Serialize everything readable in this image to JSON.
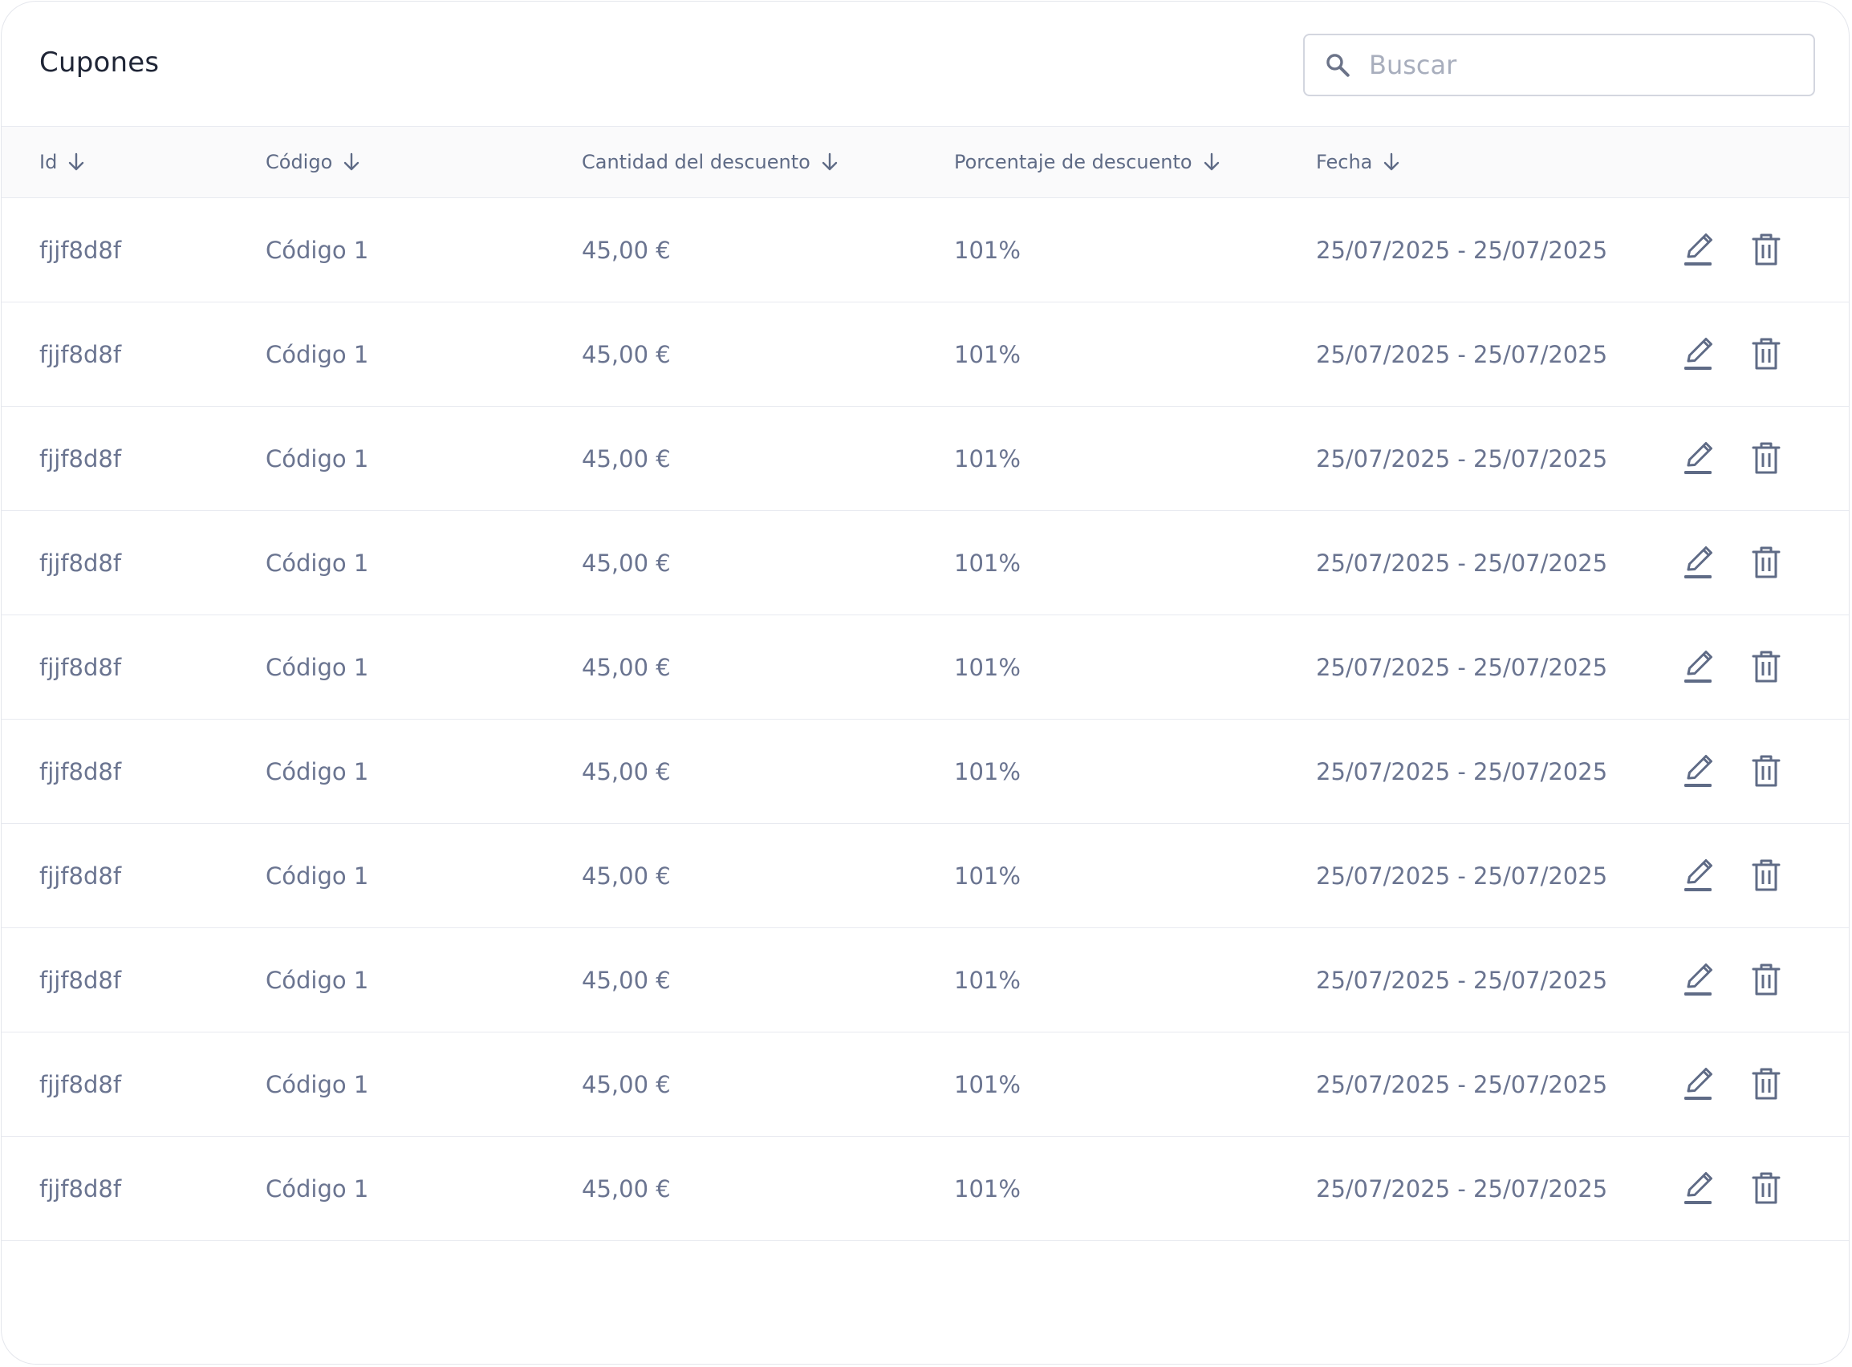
{
  "header": {
    "title": "Cupones",
    "search_placeholder": "Buscar"
  },
  "table": {
    "columns": [
      {
        "label": "Id"
      },
      {
        "label": "Código"
      },
      {
        "label": "Cantidad del descuento"
      },
      {
        "label": "Porcentaje de descuento"
      },
      {
        "label": "Fecha"
      }
    ],
    "rows": [
      {
        "id": "fjjf8d8f",
        "code": "Código 1",
        "amount": "45,00 €",
        "percent": "101%",
        "date": "25/07/2025 - 25/07/2025"
      },
      {
        "id": "fjjf8d8f",
        "code": "Código 1",
        "amount": "45,00 €",
        "percent": "101%",
        "date": "25/07/2025 - 25/07/2025"
      },
      {
        "id": "fjjf8d8f",
        "code": "Código 1",
        "amount": "45,00 €",
        "percent": "101%",
        "date": "25/07/2025 - 25/07/2025"
      },
      {
        "id": "fjjf8d8f",
        "code": "Código 1",
        "amount": "45,00 €",
        "percent": "101%",
        "date": "25/07/2025 - 25/07/2025"
      },
      {
        "id": "fjjf8d8f",
        "code": "Código 1",
        "amount": "45,00 €",
        "percent": "101%",
        "date": "25/07/2025 - 25/07/2025"
      },
      {
        "id": "fjjf8d8f",
        "code": "Código 1",
        "amount": "45,00 €",
        "percent": "101%",
        "date": "25/07/2025 - 25/07/2025"
      },
      {
        "id": "fjjf8d8f",
        "code": "Código 1",
        "amount": "45,00 €",
        "percent": "101%",
        "date": "25/07/2025 - 25/07/2025"
      },
      {
        "id": "fjjf8d8f",
        "code": "Código 1",
        "amount": "45,00 €",
        "percent": "101%",
        "date": "25/07/2025 - 25/07/2025"
      },
      {
        "id": "fjjf8d8f",
        "code": "Código 1",
        "amount": "45,00 €",
        "percent": "101%",
        "date": "25/07/2025 - 25/07/2025"
      },
      {
        "id": "fjjf8d8f",
        "code": "Código 1",
        "amount": "45,00 €",
        "percent": "101%",
        "date": "25/07/2025 - 25/07/2025"
      }
    ],
    "row_actions": [
      "pencil-icon",
      "trash-icon"
    ],
    "sort_icon": "arrow-down-icon"
  },
  "colors": {
    "title_text": "#1f2536",
    "body_text": "#6a7490",
    "header_bg": "#fafafb",
    "border": "#e8eaf0",
    "icon": "#5f6b86"
  }
}
